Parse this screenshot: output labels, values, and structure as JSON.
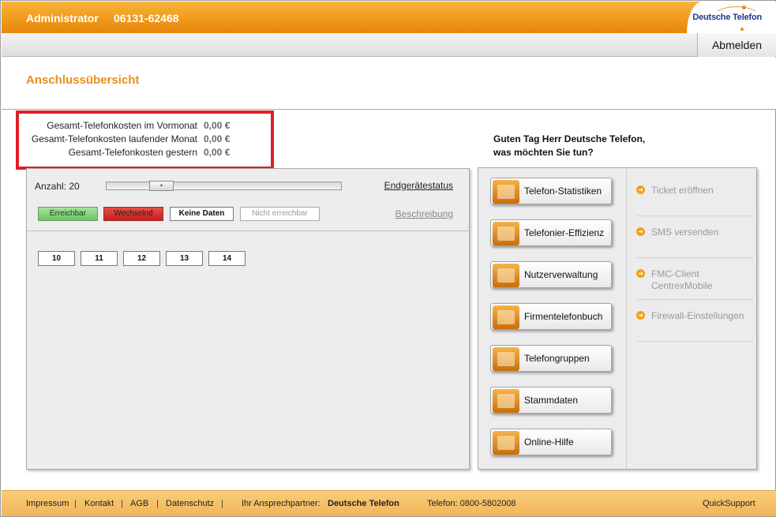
{
  "header": {
    "user": "Administrator",
    "phone": "06131-62468",
    "logo_text": "Deutsche Telefon",
    "logout_label": "Abmelden",
    "page_title": "Anschlussübersicht"
  },
  "costs": [
    {
      "label": "Gesamt-Telefonkosten im Vormonat",
      "value": "0,00 €"
    },
    {
      "label": "Gesamt-Telefonkosten laufender Monat",
      "value": "0,00 €"
    },
    {
      "label": "Gesamt-Telefonkosten gestern",
      "value": "0,00 €"
    }
  ],
  "left_panel": {
    "anzahl_label": "Anzahl: 20",
    "endgeraete_link": "Endgerätestatus",
    "beschreibung_link": "Beschreibung",
    "status_filters": [
      "Erreichbar",
      "Wechselnd",
      "Keine Daten",
      "Nicht erreichbar"
    ],
    "ports": [
      "10",
      "11",
      "12",
      "13",
      "14"
    ]
  },
  "greeting": {
    "line1": "Guten Tag Herr Deutsche Telefon,",
    "line2": "was möchten Sie tun?"
  },
  "actions": [
    {
      "label": "Telefon-Statistiken",
      "icon": "statistics-icon"
    },
    {
      "label": "Telefonier-Effizienz",
      "icon": "efficiency-chart-icon"
    },
    {
      "label": "Nutzerverwaltung",
      "icon": "user-icon"
    },
    {
      "label": "Firmentelefonbuch",
      "icon": "phonebook-icon"
    },
    {
      "label": "Telefongruppen",
      "icon": "group-icon"
    },
    {
      "label": "Stammdaten",
      "icon": "master-data-icon"
    },
    {
      "label": "Online-Hilfe",
      "icon": "book-icon"
    }
  ],
  "links": [
    {
      "line1": "Ticket eröffnen",
      "line2": ""
    },
    {
      "line1": "SMS versenden",
      "line2": ""
    },
    {
      "line1": "FMC-Client",
      "line2": "CentrexMobile"
    },
    {
      "line1": "Firewall-Einstellungen",
      "line2": ""
    }
  ],
  "footer": {
    "impressum": "Impressum",
    "kontakt": "Kontakt",
    "agb": "AGB",
    "datenschutz": "Datenschutz",
    "partner_label": "Ihr Ansprechpartner:",
    "partner_name": "Deutsche Telefon",
    "telefon": "Telefon: 0800-5802008",
    "quicksupport": "QuickSupport",
    "separator": "|"
  },
  "colors": {
    "accent_orange": "#f09a1a",
    "title_orange": "#e8901a",
    "highlight_red": "#e21d2a",
    "status_green": "#6ec266",
    "status_red": "#c7201c"
  }
}
